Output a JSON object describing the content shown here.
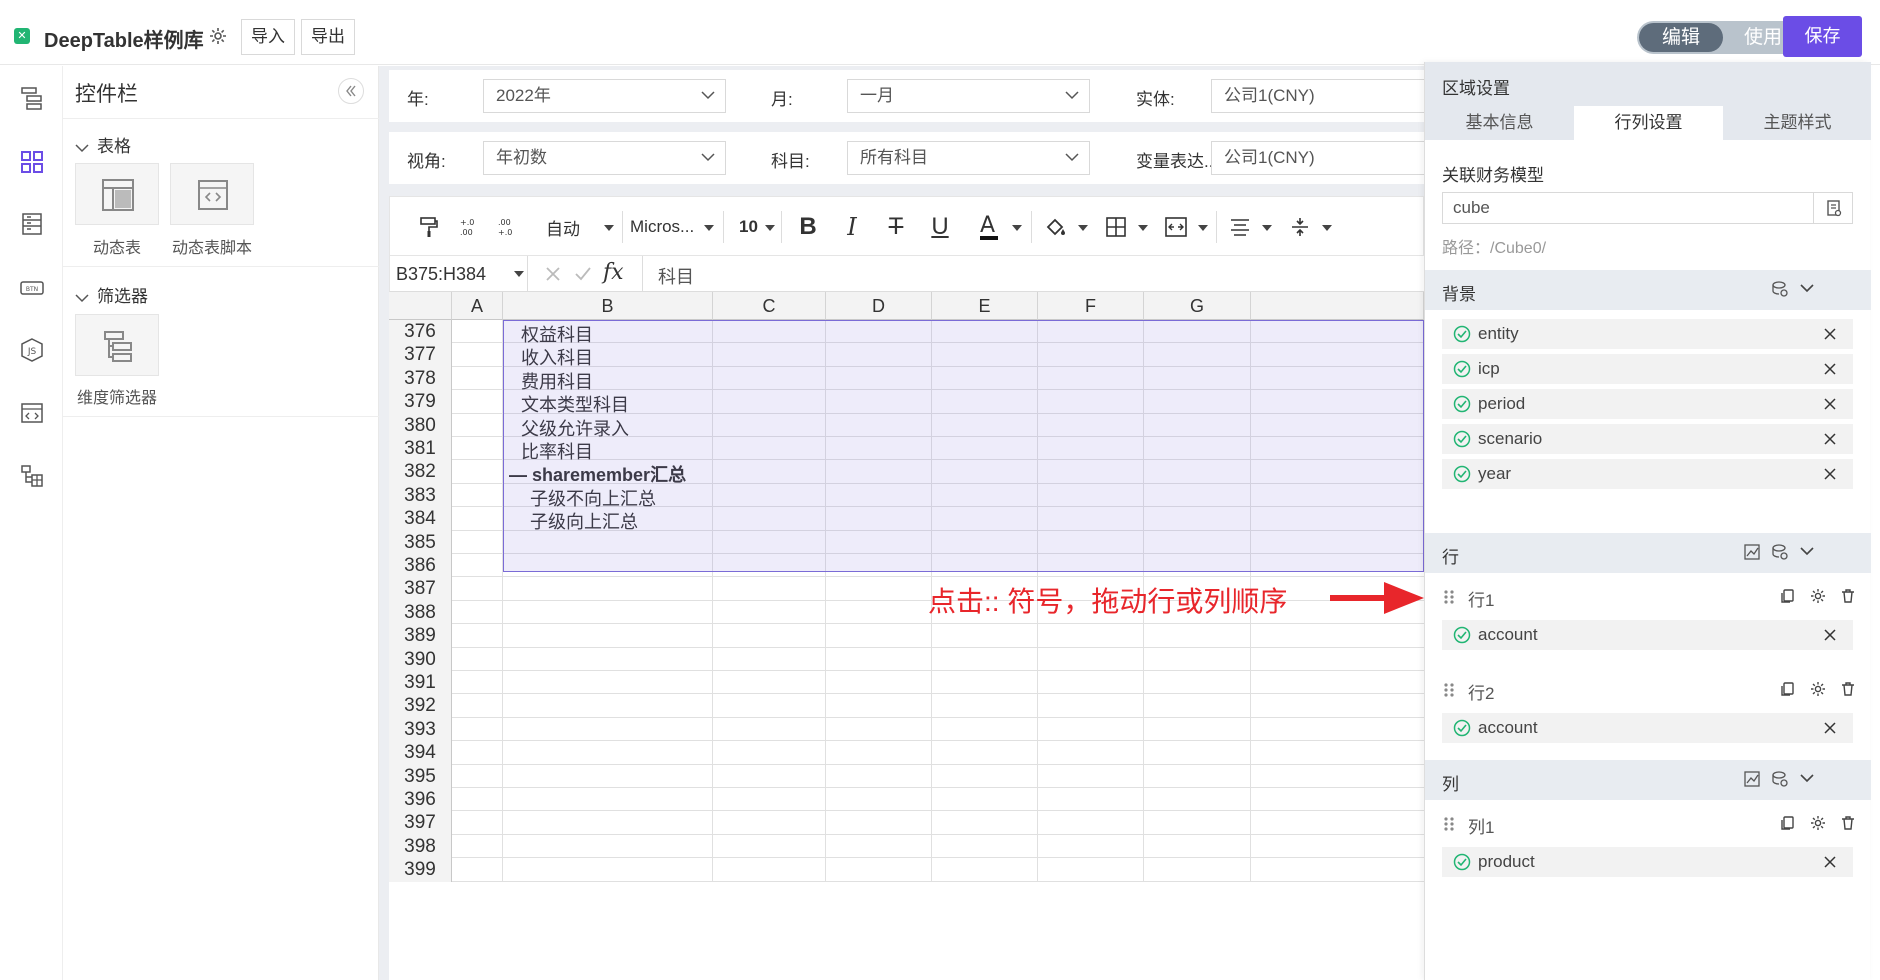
{
  "header": {
    "app_title": "DeepTable样例库",
    "import_label": "导入",
    "export_label": "导出",
    "mode_edit": "编辑",
    "mode_use": "使用",
    "save_label": "保存"
  },
  "widgets": {
    "title": "控件栏",
    "sections": [
      {
        "label": "表格",
        "items": [
          "动态表",
          "动态表脚本"
        ]
      },
      {
        "label": "筛选器",
        "items": [
          "维度筛选器"
        ]
      }
    ]
  },
  "filters": {
    "row1": [
      {
        "label": "年:",
        "value": "2022年"
      },
      {
        "label": "月:",
        "value": "一月"
      },
      {
        "label": "实体:",
        "value": "公司1(CNY)"
      }
    ],
    "row2": [
      {
        "label": "视角:",
        "value": "年初数"
      },
      {
        "label": "科目:",
        "value": "所有科目"
      },
      {
        "label": "变量表达...",
        "value": "公司1(CNY)"
      }
    ]
  },
  "toolbar": {
    "format": "自动",
    "font": "Micros...",
    "size": "10"
  },
  "formula_bar": {
    "cell_ref": "B375:H384",
    "fx": "fx",
    "formula": "科目"
  },
  "grid": {
    "columns": [
      "A",
      "B",
      "C",
      "D",
      "E",
      "F",
      "G"
    ],
    "rows": [
      {
        "num": "376",
        "b": "权益科目"
      },
      {
        "num": "377",
        "b": "收入科目"
      },
      {
        "num": "378",
        "b": "费用科目"
      },
      {
        "num": "379",
        "b": "文本类型科目"
      },
      {
        "num": "380",
        "b": "父级允许录入"
      },
      {
        "num": "381",
        "b": "比率科目"
      },
      {
        "num": "382",
        "b": "— sharemember汇总"
      },
      {
        "num": "383",
        "b": "子级不向上汇总"
      },
      {
        "num": "384",
        "b": "子级向上汇总"
      },
      {
        "num": "385",
        "b": ""
      },
      {
        "num": "386",
        "b": ""
      },
      {
        "num": "387",
        "b": ""
      },
      {
        "num": "388",
        "b": ""
      },
      {
        "num": "389",
        "b": ""
      },
      {
        "num": "390",
        "b": ""
      },
      {
        "num": "391",
        "b": ""
      },
      {
        "num": "392",
        "b": ""
      },
      {
        "num": "393",
        "b": ""
      },
      {
        "num": "394",
        "b": ""
      },
      {
        "num": "395",
        "b": ""
      },
      {
        "num": "396",
        "b": ""
      },
      {
        "num": "397",
        "b": ""
      },
      {
        "num": "398",
        "b": ""
      },
      {
        "num": "399",
        "b": ""
      }
    ]
  },
  "annotation": "点击:: 符号，拖动行或列顺序",
  "panel": {
    "title": "区域设置",
    "tabs": [
      "基本信息",
      "行列设置",
      "主题样式"
    ],
    "model_label": "关联财务模型",
    "model_value": "cube",
    "path": "路径：/Cube0/",
    "background": {
      "title": "背景",
      "dims": [
        "entity",
        "icp",
        "period",
        "scenario",
        "year"
      ]
    },
    "rows": {
      "title": "行",
      "groups": [
        {
          "label": "行1",
          "dims": [
            "account"
          ]
        },
        {
          "label": "行2",
          "dims": [
            "account"
          ]
        }
      ]
    },
    "cols": {
      "title": "列",
      "groups": [
        {
          "label": "列1",
          "dims": [
            "product"
          ]
        }
      ]
    }
  },
  "colors": {
    "accent": "#6b4de6",
    "selection": "#7a6bd6",
    "annotation": "#e8262b",
    "check": "#21b573"
  }
}
